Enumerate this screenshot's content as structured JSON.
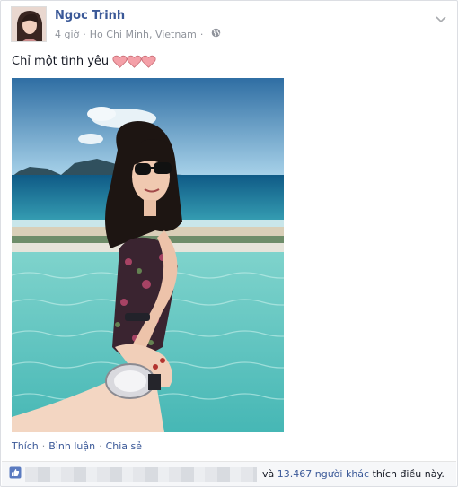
{
  "post": {
    "author": "Ngoc Trinh",
    "time": "4 giờ",
    "separator": "·",
    "location": "Ho Chi Minh, Vietnam",
    "status_text": "Chỉ một tình yêu",
    "emoji_count": 3
  },
  "actions": {
    "like": "Thích",
    "comment": "Bình luận",
    "share": "Chia sẻ",
    "dot": "·"
  },
  "likes": {
    "prefix": "và",
    "count": "13.467 người khác",
    "suffix": "thích điều này."
  },
  "colors": {
    "link": "#3b5998",
    "meta": "#90949c",
    "heart": "#f4a0a8"
  }
}
